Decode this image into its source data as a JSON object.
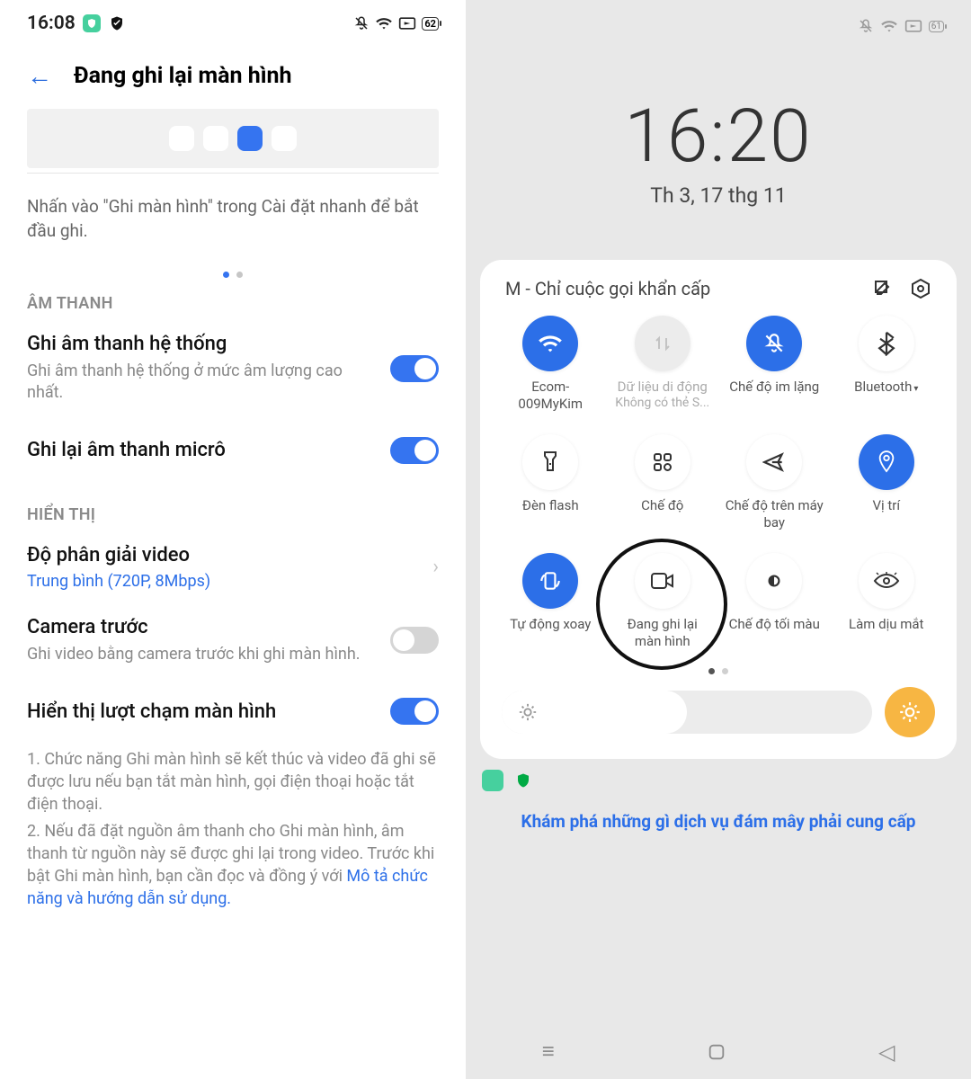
{
  "left": {
    "status": {
      "time": "16:08",
      "battery": "62"
    },
    "header_title": "Đang ghi lại màn hình",
    "hint": "Nhấn vào \"Ghi màn hình\" trong Cài đặt nhanh để bắt đầu ghi.",
    "section_audio": "ÂM THANH",
    "sys_audio": {
      "title": "Ghi âm thanh hệ thống",
      "sub": "Ghi âm thanh hệ thống ở mức âm lượng cao nhất."
    },
    "mic_audio": {
      "title": "Ghi lại âm thanh micrô"
    },
    "section_display": "HIỂN THỊ",
    "resolution": {
      "title": "Độ phân giải video",
      "value": "Trung bình (720P, 8Mbps)"
    },
    "front_cam": {
      "title": "Camera trước",
      "sub": "Ghi video bằng camera trước khi ghi màn hình."
    },
    "show_touch": {
      "title": "Hiển thị lượt chạm màn hình"
    },
    "note1": "1. Chức năng Ghi màn hình sẽ kết thúc và video đã ghi sẽ được lưu nếu bạn tắt màn hình, gọi điện thoại hoặc tắt điện thoại.",
    "note2_a": "2. Nếu đã đặt nguồn âm thanh cho Ghi màn hình, âm thanh từ nguồn này sẽ được ghi lại trong video. Trước khi bật Ghi màn hình, bạn cần đọc và đồng ý với ",
    "note2_link": "Mô tả chức năng và hướng dẫn sử dụng."
  },
  "right": {
    "status": {
      "battery": "61"
    },
    "clock_time": "16:20",
    "clock_date": "Th 3, 17 thg 11",
    "carrier": "M - Chỉ cuộc gọi khẩn cấp",
    "tiles": {
      "wifi": {
        "label": "Ecom-009MyKim"
      },
      "data": {
        "label": "Dữ liệu di động",
        "sub": "Không có thẻ S..."
      },
      "silent": {
        "label": "Chế độ im lặng"
      },
      "bt": {
        "label": "Bluetooth"
      },
      "flash": {
        "label": "Đèn flash"
      },
      "mode": {
        "label": "Chế độ"
      },
      "airplane": {
        "label": "Chế độ trên máy bay"
      },
      "location": {
        "label": "Vị trí"
      },
      "rotate": {
        "label": "Tự động xoay"
      },
      "record": {
        "label": "Đang ghi lại màn hình"
      },
      "dark": {
        "label": "Chế độ tối màu"
      },
      "eye": {
        "label": "Làm dịu mắt"
      }
    },
    "cloud": "Khám phá những gì dịch vụ đám mây phải cung cấp"
  }
}
